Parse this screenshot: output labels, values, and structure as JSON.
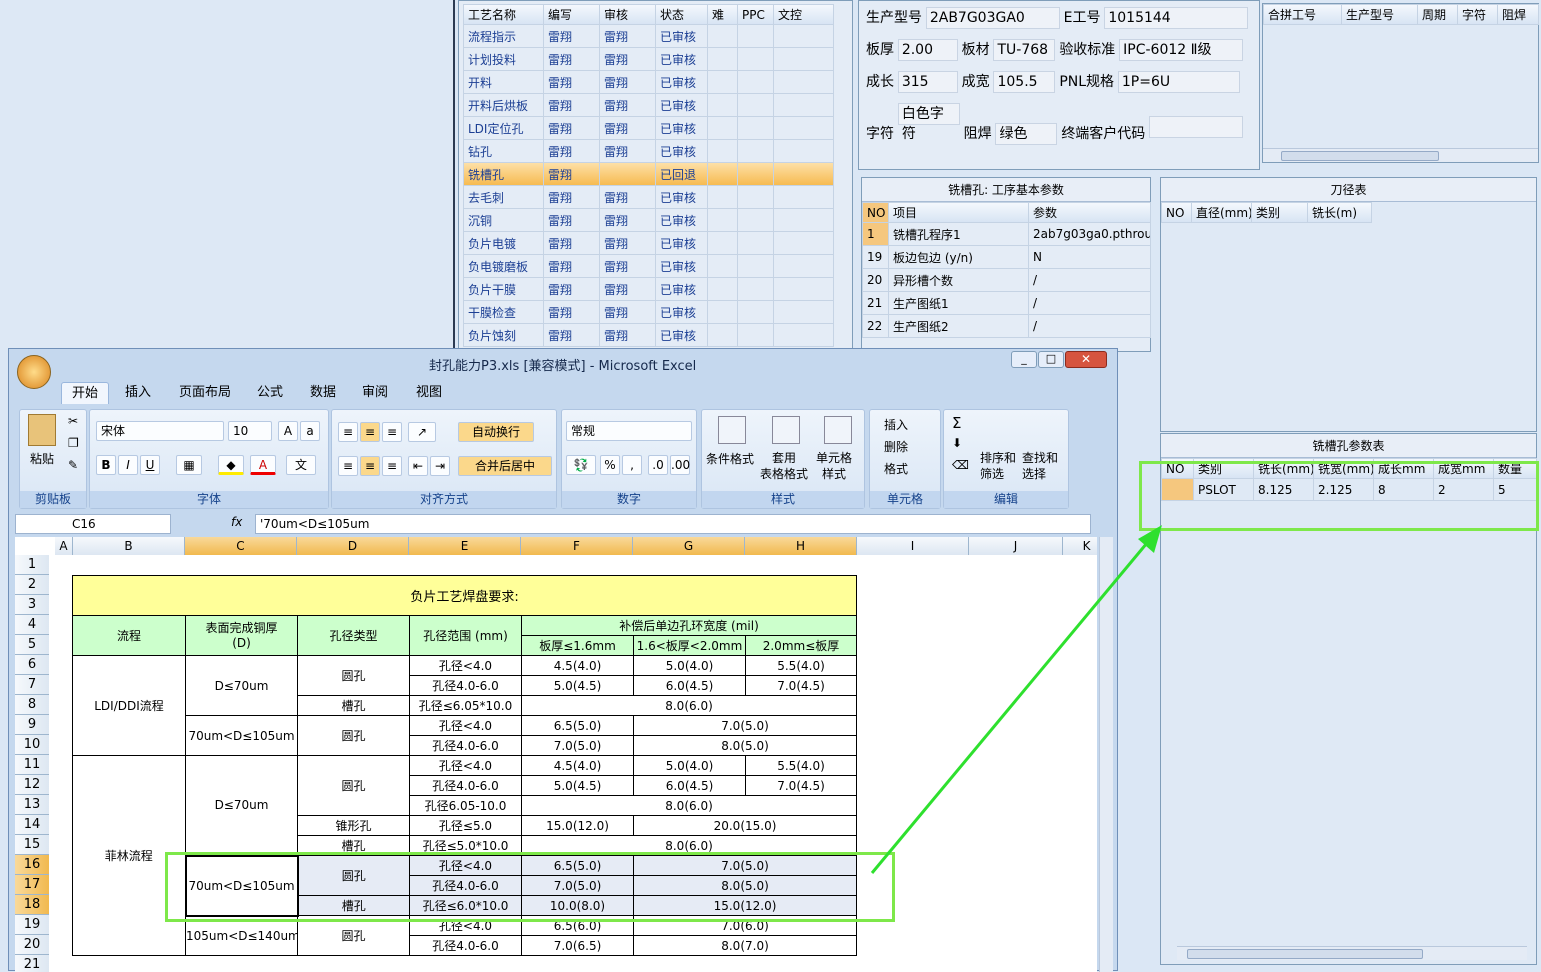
{
  "process_list": {
    "headers": [
      "工艺名称",
      "编写",
      "审核",
      "状态",
      "难",
      "PPC",
      "文控"
    ],
    "rows": [
      [
        "流程指示",
        "雷翔",
        "雷翔",
        "已审核"
      ],
      [
        "计划投料",
        "雷翔",
        "雷翔",
        "已审核"
      ],
      [
        "开料",
        "雷翔",
        "雷翔",
        "已审核"
      ],
      [
        "开料后烘板",
        "雷翔",
        "雷翔",
        "已审核"
      ],
      [
        "LDI定位孔",
        "雷翔",
        "雷翔",
        "已审核"
      ],
      [
        "钻孔",
        "雷翔",
        "雷翔",
        "已审核"
      ],
      [
        "铣槽孔",
        "雷翔",
        "",
        "已回退"
      ],
      [
        "去毛刺",
        "雷翔",
        "雷翔",
        "已审核"
      ],
      [
        "沉铜",
        "雷翔",
        "雷翔",
        "已审核"
      ],
      [
        "负片电镀",
        "雷翔",
        "雷翔",
        "已审核"
      ],
      [
        "负电镀磨板",
        "雷翔",
        "雷翔",
        "已审核"
      ],
      [
        "负片干膜",
        "雷翔",
        "雷翔",
        "已审核"
      ],
      [
        "干膜检查",
        "雷翔",
        "雷翔",
        "已审核"
      ],
      [
        "负片蚀刻",
        "雷翔",
        "雷翔",
        "已审核"
      ]
    ]
  },
  "info": {
    "prod_model_label": "生产型号",
    "prod_model": "2AB7G03GA0",
    "e_no_label": "E工号",
    "e_no": "1015144",
    "thickness_label": "板厚",
    "thickness": "2.00",
    "material_label": "板材",
    "material": "TU-768",
    "std_label": "验收标准",
    "std": "IPC-6012 Ⅱ级",
    "length_label": "成长",
    "length": "315",
    "width_label": "成宽",
    "width": "105.5",
    "pnl_label": "PNL规格",
    "pnl": "1P=6U",
    "char_label": "字符",
    "char": "白色字符",
    "mask_label": "阻焊",
    "mask": "绿色",
    "customer_label": "终端客户代码",
    "customer": ""
  },
  "combo": {
    "headers": [
      "合拼工号",
      "生产型号",
      "周期",
      "字符",
      "阻焊"
    ]
  },
  "basic_params": {
    "title": "铣槽孔: 工序基本参数",
    "headers": [
      "NO",
      "项目",
      "参数"
    ],
    "rows": [
      [
        "1",
        "铣槽孔程序1",
        "2ab7g03ga0.pthrou"
      ],
      [
        "19",
        "板边包边 (y/n)",
        "N"
      ],
      [
        "20",
        "异形槽个数",
        "/"
      ],
      [
        "21",
        "生产图纸1",
        "/"
      ],
      [
        "22",
        "生产图纸2",
        "/"
      ]
    ]
  },
  "tool_table": {
    "title": "刀径表",
    "headers": [
      "NO",
      "直径(mm)",
      "类别",
      "铣长(m)"
    ]
  },
  "slot_params": {
    "title": "铣槽孔参数表",
    "headers": [
      "NO",
      "类别",
      "铣长(mm)",
      "铣宽(mm)",
      "成长mm",
      "成宽mm",
      "数量"
    ],
    "rows": [
      [
        "",
        "PSLOT",
        "8.125",
        "2.125",
        "8",
        "2",
        "5"
      ]
    ]
  },
  "excel": {
    "title": "封孔能力P3.xls [兼容模式] - Microsoft Excel",
    "tabs": [
      "开始",
      "插入",
      "页面布局",
      "公式",
      "数据",
      "审阅",
      "视图"
    ],
    "font_name": "宋体",
    "font_size": "10",
    "number_format": "常规",
    "wrap_label": "自动换行",
    "merge_label": "合并后居中",
    "groups": {
      "clipboard": "剪贴板",
      "font": "字体",
      "align": "对齐方式",
      "number": "数字",
      "style": "样式",
      "cells": "单元格",
      "edit": "编辑"
    },
    "paste": "粘贴",
    "cond": "条件格式",
    "table_fmt": "套用\n表格格式",
    "cell_style": "单元格\n样式",
    "insert": "插入",
    "delete": "删除",
    "format": "格式",
    "sort": "排序和\n筛选",
    "find": "查找和\n选择",
    "name_box": "C16",
    "formula": "'70um<D≤105um",
    "columns": [
      "A",
      "B",
      "C",
      "D",
      "E",
      "F",
      "G",
      "H",
      "I",
      "J",
      "K"
    ],
    "rows": [
      "1",
      "2",
      "3",
      "4",
      "5",
      "6",
      "7",
      "8",
      "9",
      "10",
      "11",
      "12",
      "13",
      "14",
      "15",
      "16",
      "17",
      "18",
      "19",
      "20",
      "21"
    ],
    "sheet": {
      "title": "负片工艺焊盘要求:",
      "h_flow": "流程",
      "h_cu": "表面完成铜厚\n(D)",
      "h_type": "孔径类型",
      "h_range": "孔径范围 (mm)",
      "h_comp": "补偿后单边孔环宽度 (mil)",
      "h_t1": "板厚≤1.6mm",
      "h_t2": "1.6<板厚<2.0mm",
      "h_t3": "2.0mm≤板厚",
      "flow1": "LDI/DDI流程",
      "flow2": "菲林流程",
      "d1": "D≤70um",
      "d2": "70um<D≤105um",
      "d3": "105um<D≤140um",
      "round": "圆孔",
      "slot": "槽孔",
      "cone": "锥形孔",
      "r1": "孔径<4.0",
      "r2": "孔径4.0-6.0",
      "r3": "孔径≤6.05*10.0",
      "r4": "孔径6.05-10.0",
      "r5": "孔径≤5.0",
      "r6": "孔径≤5.0*10.0",
      "r7": "孔径≤6.0*10.0",
      "v_a": "4.5(4.0)",
      "v_b": "5.0(4.0)",
      "v_c": "5.5(4.0)",
      "v_d": "5.0(4.5)",
      "v_e": "6.0(4.5)",
      "v_f": "7.0(4.5)",
      "v_g": "8.0(6.0)",
      "v_h": "6.5(5.0)",
      "v_i": "7.0(5.0)",
      "v_j": "8.0(5.0)",
      "v_k": "15.0(12.0)",
      "v_l": "20.0(15.0)",
      "v_m": "10.0(8.0)",
      "v_n": "6.5(6.0)",
      "v_o": "7.0(6.0)",
      "v_p": "7.0(6.5)",
      "v_q": "8.0(7.0)"
    }
  }
}
